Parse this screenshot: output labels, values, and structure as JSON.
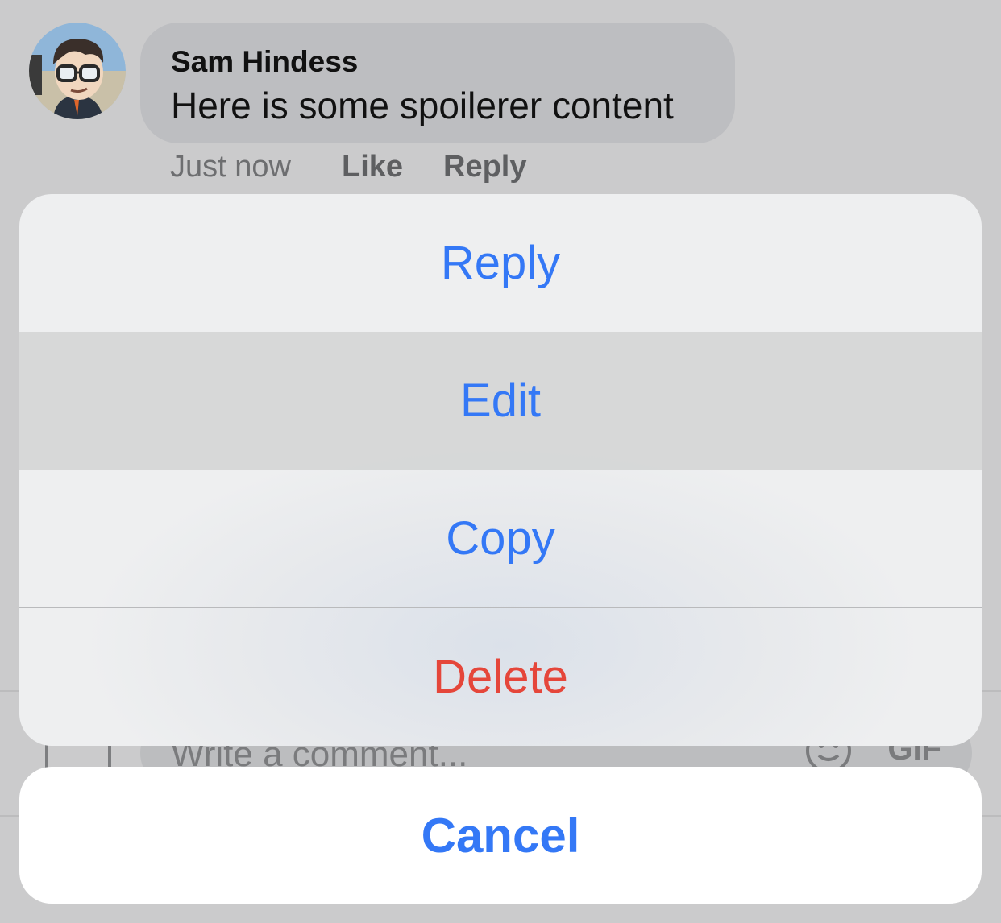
{
  "comment": {
    "author": "Sam Hindess",
    "text": "Here is some spoilerer content",
    "timestamp": "Just now",
    "like_label": "Like",
    "reply_label": "Reply"
  },
  "composer": {
    "placeholder": "Write a comment...",
    "gif_label": "GIF"
  },
  "action_sheet": {
    "items": [
      {
        "label": "Reply"
      },
      {
        "label": "Edit"
      },
      {
        "label": "Copy"
      },
      {
        "label": "Delete"
      }
    ],
    "cancel_label": "Cancel"
  },
  "colors": {
    "action_blue": "#3478f6",
    "destructive_red": "#e5463a"
  }
}
